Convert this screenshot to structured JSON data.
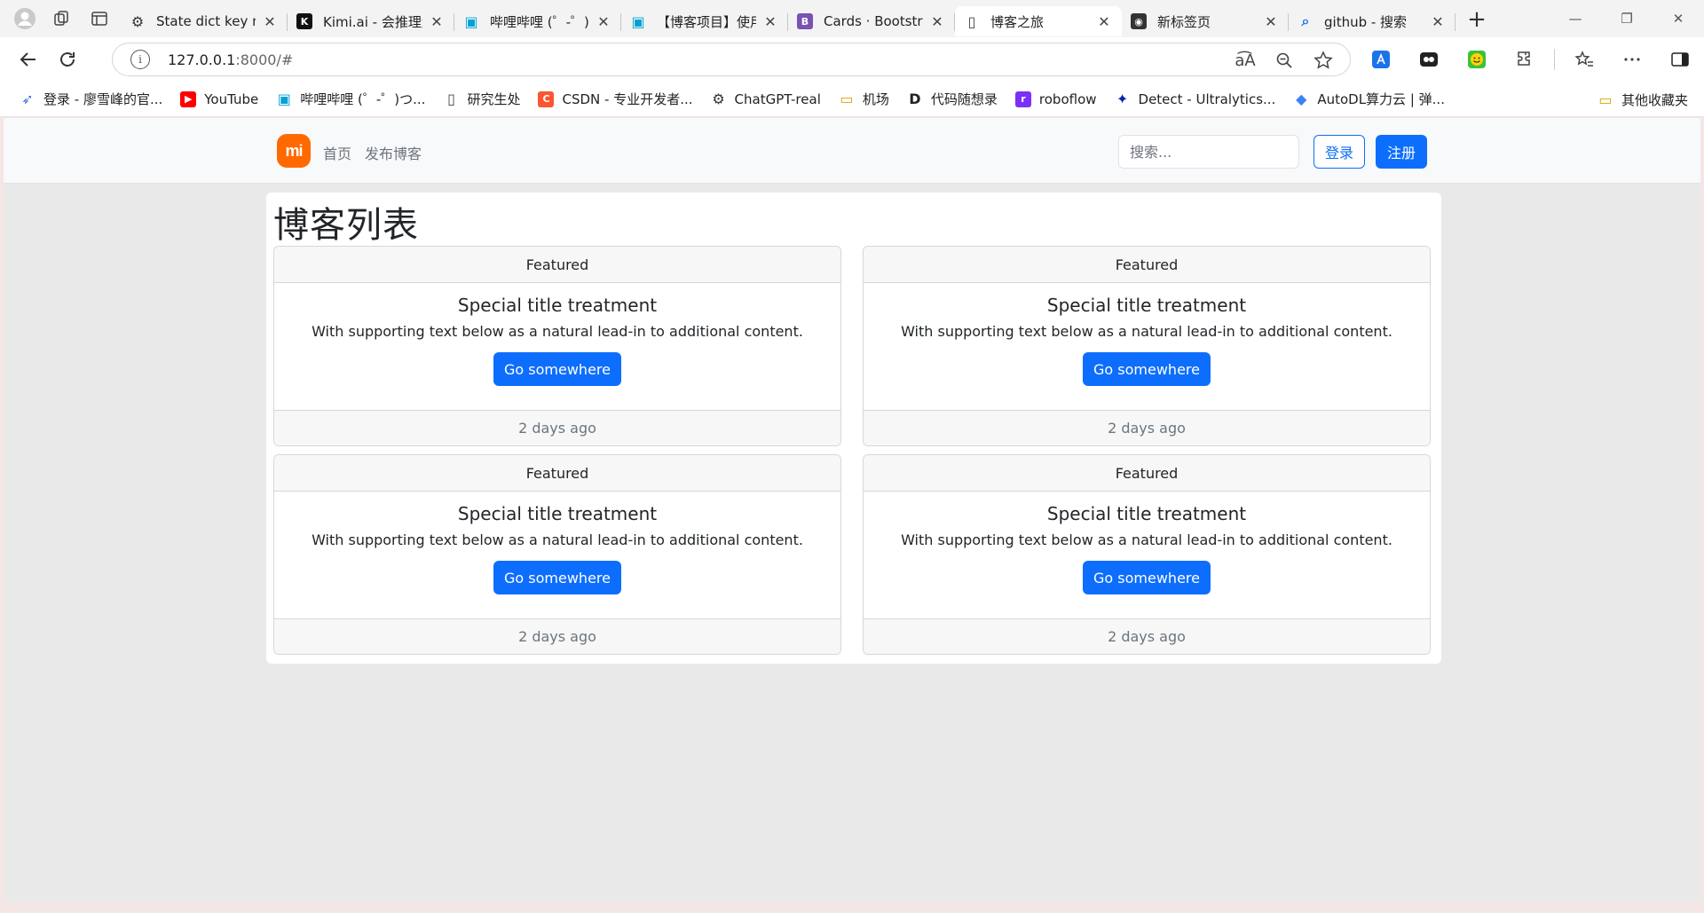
{
  "browser": {
    "tabs": [
      {
        "title": "State dict key mi",
        "favicon": "chatgpt-icon",
        "active": false
      },
      {
        "title": "Kimi.ai - 会推理解",
        "favicon": "kimi-icon",
        "active": false
      },
      {
        "title": "哔哩哔哩 (゜-゜)",
        "favicon": "bilibili-icon",
        "active": false
      },
      {
        "title": "【博客项目】使用",
        "favicon": "bilibili-icon",
        "active": false
      },
      {
        "title": "Cards · Bootstrap",
        "favicon": "bootstrap-icon",
        "active": false
      },
      {
        "title": "博客之旅",
        "favicon": "page-icon",
        "active": true
      },
      {
        "title": "新标签页",
        "favicon": "github-icon",
        "active": false
      },
      {
        "title": "github - 搜索",
        "favicon": "search-icon",
        "active": false
      }
    ],
    "address": {
      "host": "127.0.0.1",
      "rest": ":8000/#"
    },
    "bookmarks": [
      {
        "label": "登录 - 廖雪峰的官...",
        "icon": "rocket-icon"
      },
      {
        "label": "YouTube",
        "icon": "youtube-icon"
      },
      {
        "label": "哔哩哔哩 (゜-゜)つ...",
        "icon": "bilibili-icon"
      },
      {
        "label": "研究生处",
        "icon": "page-icon"
      },
      {
        "label": "CSDN - 专业开发者...",
        "icon": "csdn-icon"
      },
      {
        "label": "ChatGPT-real",
        "icon": "chatgpt-icon"
      },
      {
        "label": "机场",
        "icon": "folder-icon"
      },
      {
        "label": "代码随想录",
        "icon": "code-icon"
      },
      {
        "label": "roboflow",
        "icon": "roboflow-icon"
      },
      {
        "label": "Detect - Ultralytics...",
        "icon": "ultralytics-icon"
      },
      {
        "label": "AutoDL算力云 | 弹...",
        "icon": "autodl-icon"
      }
    ],
    "bookmarks_other": "其他收藏夹"
  },
  "site": {
    "brand": "mi",
    "nav": {
      "home": "首页",
      "publish": "发布博客"
    },
    "search_placeholder": "搜索...",
    "login": "登录",
    "register": "注册"
  },
  "main": {
    "title": "博客列表",
    "cards": [
      {
        "header": "Featured",
        "title": "Special title treatment",
        "text": "With supporting text below as a natural lead-in to additional content.",
        "button": "Go somewhere",
        "footer": "2 days ago"
      },
      {
        "header": "Featured",
        "title": "Special title treatment",
        "text": "With supporting text below as a natural lead-in to additional content.",
        "button": "Go somewhere",
        "footer": "2 days ago"
      },
      {
        "header": "Featured",
        "title": "Special title treatment",
        "text": "With supporting text below as a natural lead-in to additional content.",
        "button": "Go somewhere",
        "footer": "2 days ago"
      },
      {
        "header": "Featured",
        "title": "Special title treatment",
        "text": "With supporting text below as a natural lead-in to additional content.",
        "button": "Go somewhere",
        "footer": "2 days ago"
      }
    ]
  },
  "colors": {
    "primary": "#0d6efd",
    "brand": "#ff6900",
    "muted": "#6c757d",
    "page_bg": "#e9e9e9"
  }
}
